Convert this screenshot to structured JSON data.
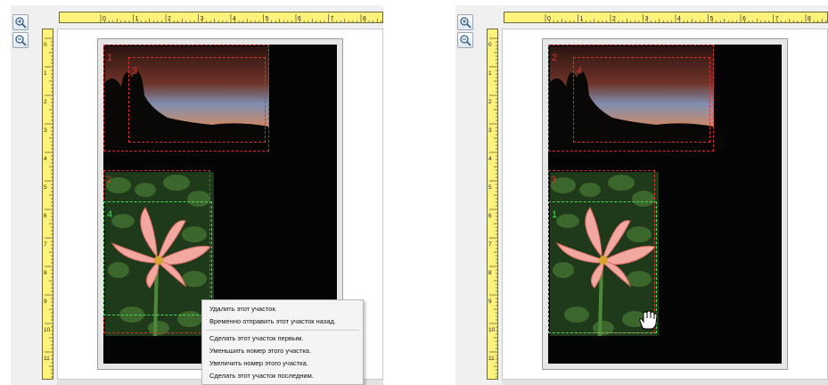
{
  "left_panel": {
    "regions": [
      {
        "number": "1",
        "color": "#d63333"
      },
      {
        "number": "3",
        "color": "#d63333"
      },
      {
        "number": "2",
        "color": "#d63333"
      },
      {
        "number": "4",
        "color": "#49d65a"
      }
    ]
  },
  "right_panel": {
    "regions": [
      {
        "number": "2",
        "color": "#d63333"
      },
      {
        "number": "4",
        "color": "#d63333"
      },
      {
        "number": "3",
        "color": "#d63333"
      },
      {
        "number": "1",
        "color": "#49d65a"
      }
    ]
  },
  "toolbar": {
    "zoom_in_icon": "zoom-in-icon",
    "zoom_out_icon": "zoom-out-icon"
  },
  "ruler": {
    "horizontal_labels": [
      "0",
      "1",
      "2",
      "3",
      "4",
      "5",
      "6",
      "7",
      "8"
    ],
    "vertical_labels": [
      "0",
      "1",
      "2",
      "3",
      "4",
      "5",
      "6",
      "7",
      "8",
      "9",
      "10",
      "11"
    ]
  },
  "context_menu": {
    "items": [
      "Удалить этот участок.",
      "Временно отправить этот участок назад.",
      "Сделать этот участок первым.",
      "Уменьшить номер этого участка.",
      "Увеличить номер этого участка.",
      "Сделать этот участок последним."
    ]
  },
  "cursor_icon": "hand-cursor-icon",
  "colors": {
    "ruler": "#fff27a",
    "region_selected": "#49d65a",
    "region_default": "#d63333"
  }
}
